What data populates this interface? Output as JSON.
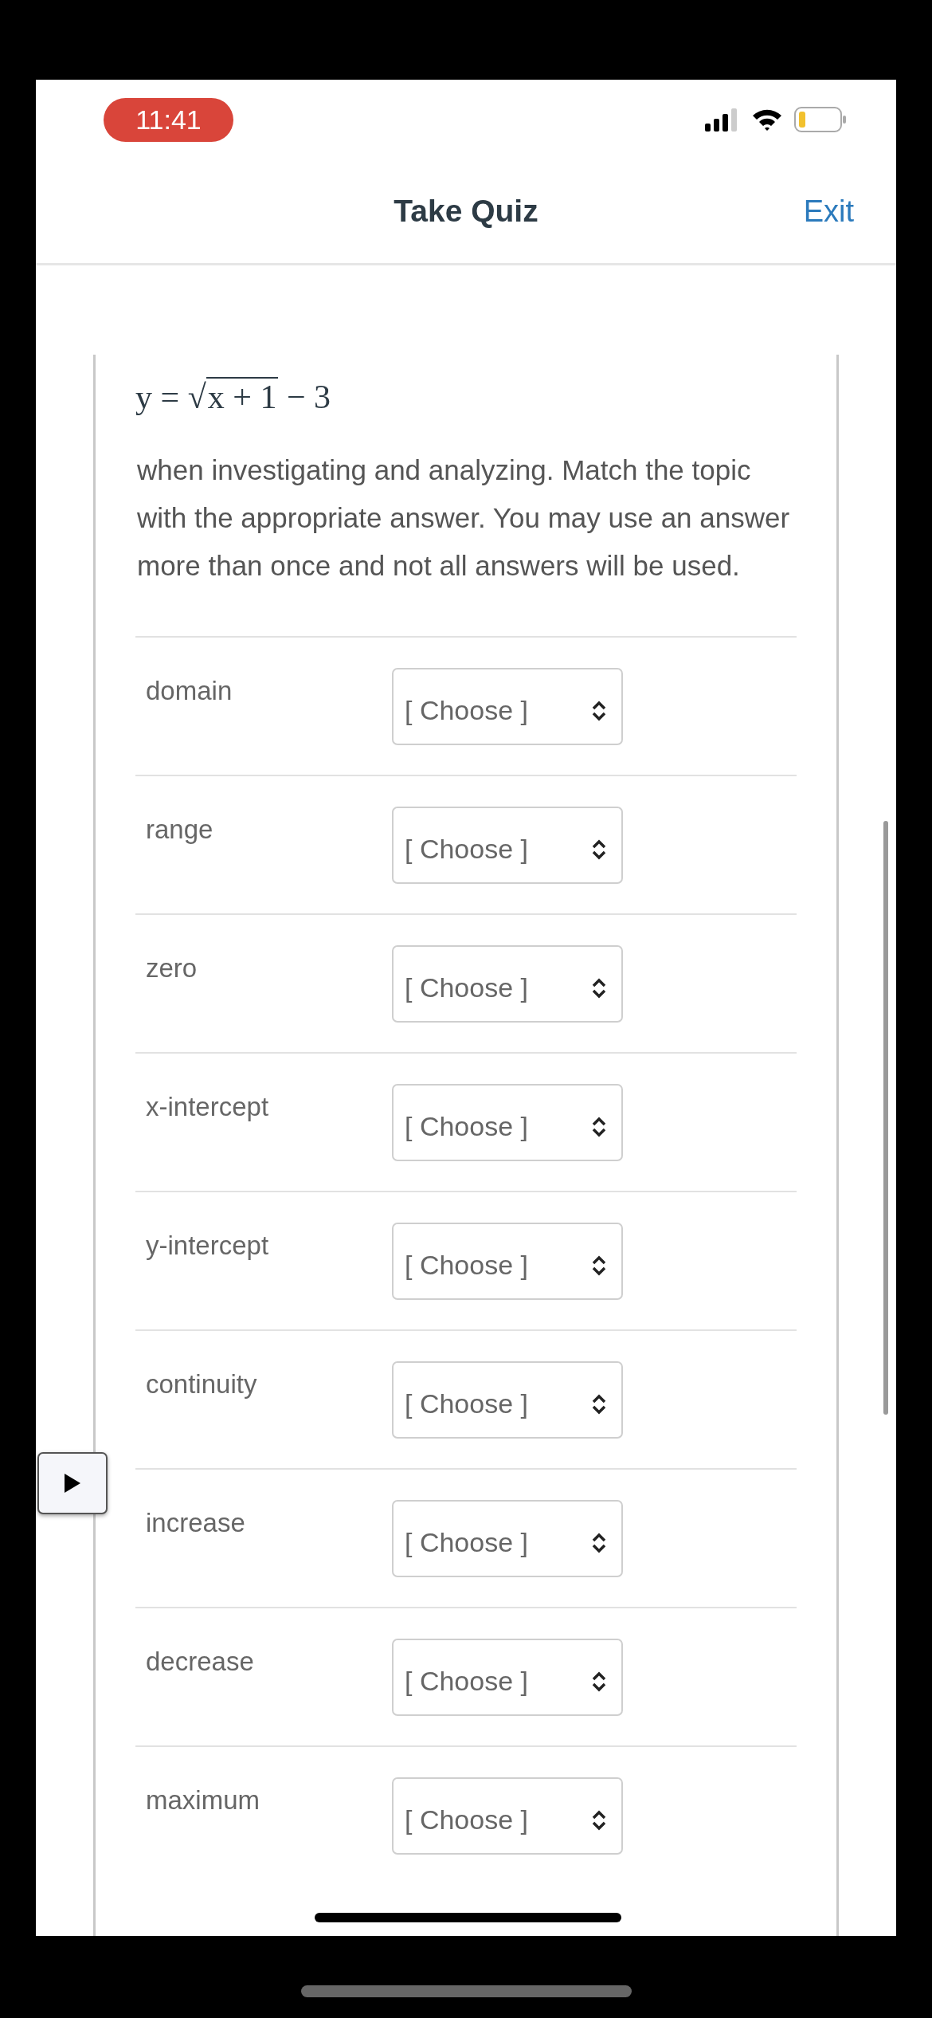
{
  "status_bar": {
    "time": "11:41"
  },
  "nav": {
    "title": "Take Quiz",
    "exit": "Exit"
  },
  "question": {
    "equation": {
      "left": "y =",
      "radical": "√",
      "radicand": "x + 1",
      "right": "− 3"
    },
    "text": "when investigating and analyzing.  Match the topic with the appropriate answer.  You may use an answer more than once and not all answers will be used."
  },
  "matches": [
    {
      "topic": "domain",
      "answer": "[ Choose ]"
    },
    {
      "topic": "range",
      "answer": "[ Choose ]"
    },
    {
      "topic": "zero",
      "answer": "[ Choose ]"
    },
    {
      "topic": "x-intercept",
      "answer": "[ Choose ]"
    },
    {
      "topic": "y-intercept",
      "answer": "[ Choose ]"
    },
    {
      "topic": "continuity",
      "answer": "[ Choose ]"
    },
    {
      "topic": "increase",
      "answer": "[ Choose ]"
    },
    {
      "topic": "decrease",
      "answer": "[ Choose ]"
    },
    {
      "topic": "maximum",
      "answer": "[ Choose ]"
    }
  ]
}
